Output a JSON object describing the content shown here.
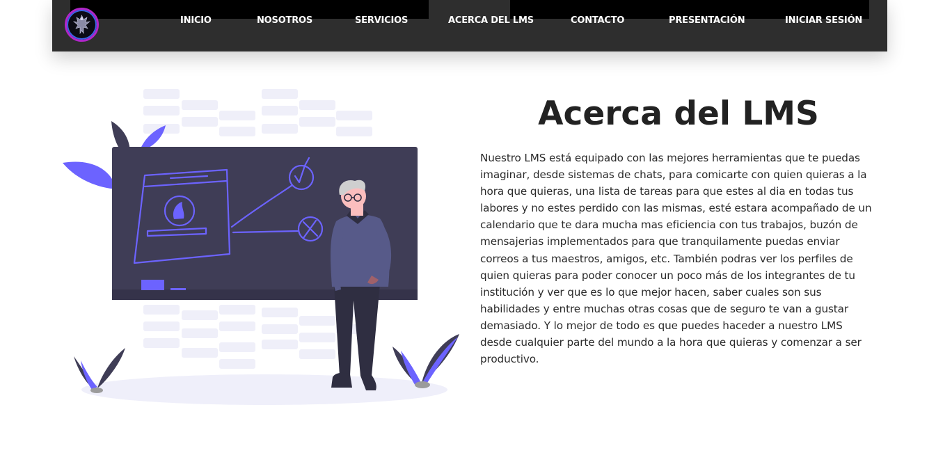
{
  "brand": {
    "logo_icon": "phoenix-logo-icon",
    "colors": {
      "ring_outer": "#b126c9",
      "ring_inner": "#3a64e6",
      "navbar": "#2e2e2e",
      "accent": "#6c63ff"
    }
  },
  "nav": {
    "items": [
      {
        "label": "INICIO"
      },
      {
        "label": "NOSOTROS"
      },
      {
        "label": "SERVICIOS"
      },
      {
        "label": "ACERCA DEL LMS"
      },
      {
        "label": "CONTACTO"
      },
      {
        "label": "PRESENTACIÓN"
      },
      {
        "label": "INICIAR SESIÓN"
      }
    ]
  },
  "about": {
    "title": "Acerca del LMS",
    "body": "Nuestro LMS está equipado con las mejores herramientas que te puedas imaginar, desde sistemas de chats, para comicarte con quien quieras a la hora que quieras, una lista de tareas para que estes al dia en todas tus labores y no estes perdido con las mismas, esté estara acompañado de un calendario que te dara mucha mas eficiencia con tus trabajos, buzón de mensajerias implementados para que tranquilamente puedas enviar correos a tus maestros, amigos, etc. También podras ver los perfiles de quien quieras para poder conocer un poco más de los integrantes de tu institución y ver que es lo que mejor hacen, saber cuales son sus habilidades y entre muchas otras cosas que de seguro te van a gustar demasiado. Y lo mejor de todo es que puedes haceder a nuestro LMS desde cualquier parte del mundo a la hora que quieras y comenzar a ser productivo."
  },
  "illustration": {
    "icon": "teacher-at-blackboard-illustration"
  }
}
